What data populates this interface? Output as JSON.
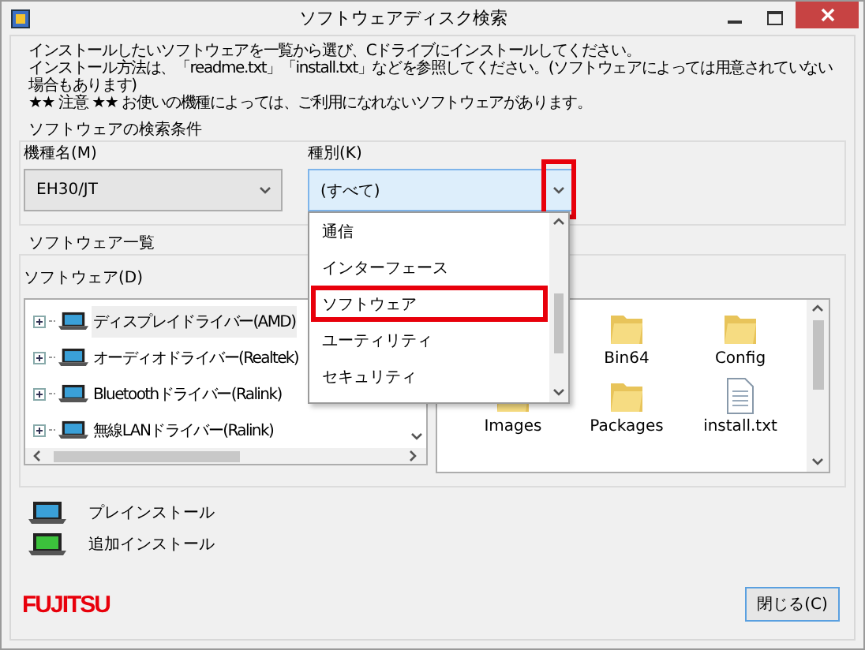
{
  "window": {
    "title": "ソフトウェアディスク検索"
  },
  "instructions": [
    "インストールしたいソフトウェアを一覧から選び、Cドライブにインストールしてください。",
    "インストール方法は、「readme.txt」「install.txt」などを参照してください。(ソフトウェアによっては用意されていない場合もあります)",
    "★★ 注意 ★★ お使いの機種によっては、ご利用になれないソフトウェアがあります。"
  ],
  "search_conditions": {
    "title": "ソフトウェアの検索条件",
    "model_label": "機種名(M)",
    "model_value": "EH30/JT",
    "category_label": "種別(K)",
    "category_value": "(すべて)",
    "arrow_highlighted": true,
    "category_options": [
      {
        "label": "通信",
        "selected": false
      },
      {
        "label": "インターフェース",
        "selected": false
      },
      {
        "label": "ソフトウェア",
        "selected": true
      },
      {
        "label": "ユーティリティ",
        "selected": false
      },
      {
        "label": "セキュリティ",
        "selected": false
      }
    ]
  },
  "software_list": {
    "title": "ソフトウェア一覧",
    "label": "ソフトウェア(D)",
    "tree": [
      {
        "label": "ディスプレイドライバー(AMD)",
        "kind": "preinstall",
        "selected": true,
        "expanded": false
      },
      {
        "label": "オーディオドライバー(Realtek)",
        "kind": "preinstall",
        "selected": false,
        "expanded": false
      },
      {
        "label": "Bluetoothドライバー(Ralink)",
        "kind": "preinstall",
        "selected": false,
        "expanded": false
      },
      {
        "label": "無線LANドライバー(Ralink)",
        "kind": "preinstall",
        "selected": false,
        "expanded": false
      }
    ],
    "file_rows": [
      [
        {
          "name": "Bin64",
          "kind": "folder"
        },
        {
          "name": "Config",
          "kind": "folder"
        }
      ],
      [
        {
          "name": "Images",
          "kind": "folder"
        },
        {
          "name": "Packages",
          "kind": "folder"
        },
        {
          "name": "install.txt",
          "kind": "text"
        }
      ]
    ]
  },
  "legend": [
    {
      "kind": "preinstall",
      "label": "プレインストール"
    },
    {
      "kind": "additional",
      "label": "追加インストール"
    }
  ],
  "logo": "FUJITSU",
  "close_button": "閉じる(C)"
}
